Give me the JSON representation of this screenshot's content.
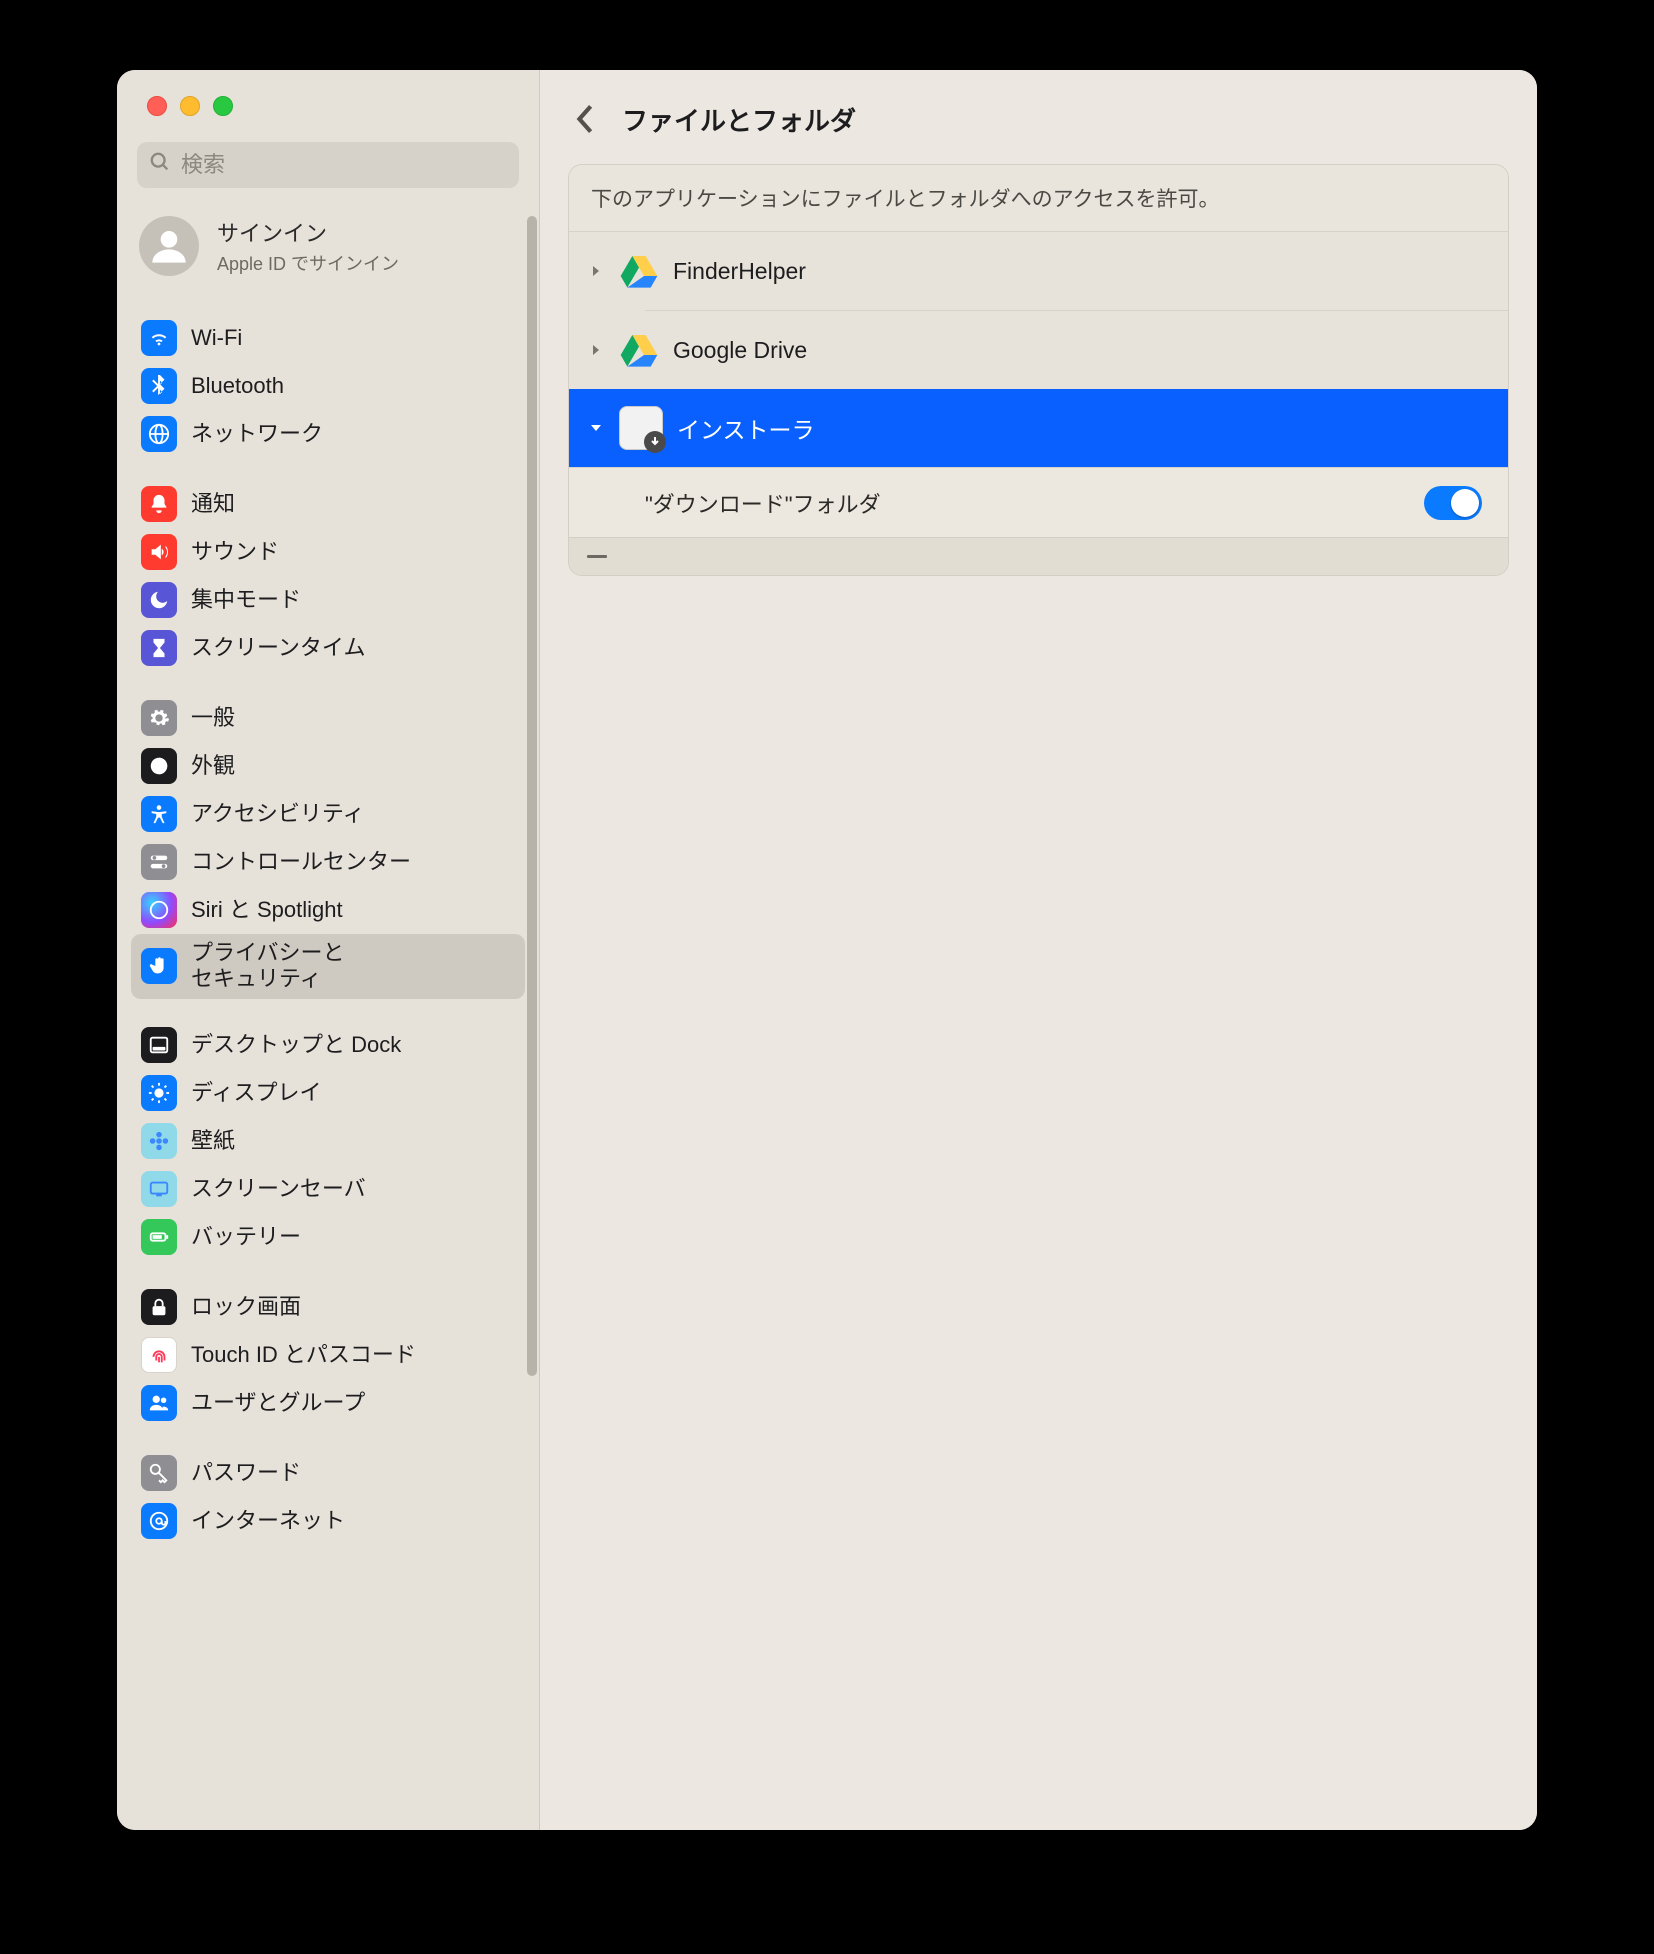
{
  "search": {
    "placeholder": "検索"
  },
  "signin": {
    "title": "サインイン",
    "subtitle": "Apple ID でサインイン"
  },
  "sidebar": {
    "groups": [
      {
        "items": [
          {
            "label": "Wi-Fi",
            "icon": "wifi-icon",
            "color": "ic-blue"
          },
          {
            "label": "Bluetooth",
            "icon": "bluetooth-icon",
            "color": "ic-blue"
          },
          {
            "label": "ネットワーク",
            "icon": "network-icon",
            "color": "ic-blue"
          }
        ]
      },
      {
        "items": [
          {
            "label": "通知",
            "icon": "bell-icon",
            "color": "ic-red"
          },
          {
            "label": "サウンド",
            "icon": "speaker-icon",
            "color": "ic-red"
          },
          {
            "label": "集中モード",
            "icon": "moon-icon",
            "color": "ic-purple"
          },
          {
            "label": "スクリーンタイム",
            "icon": "hourglass-icon",
            "color": "ic-purple"
          }
        ]
      },
      {
        "items": [
          {
            "label": "一般",
            "icon": "gear-icon",
            "color": "ic-gray"
          },
          {
            "label": "外観",
            "icon": "appearance-icon",
            "color": "ic-black"
          },
          {
            "label": "アクセシビリティ",
            "icon": "accessibility-icon",
            "color": "ic-blue"
          },
          {
            "label": "コントロールセンター",
            "icon": "switches-icon",
            "color": "ic-gray"
          },
          {
            "label": "Siri と Spotlight",
            "icon": "siri-icon",
            "color": "ic-siri"
          },
          {
            "label": "プライバシーと\nセキュリティ",
            "icon": "hand-icon",
            "color": "ic-blue",
            "selected": true
          }
        ]
      },
      {
        "items": [
          {
            "label": "デスクトップと Dock",
            "icon": "dock-icon",
            "color": "ic-black"
          },
          {
            "label": "ディスプレイ",
            "icon": "display-icon",
            "color": "ic-blue"
          },
          {
            "label": "壁紙",
            "icon": "wallpaper-icon",
            "color": "ic-cyan"
          },
          {
            "label": "スクリーンセーバ",
            "icon": "screensaver-icon",
            "color": "ic-cyan"
          },
          {
            "label": "バッテリー",
            "icon": "battery-icon",
            "color": "ic-green"
          }
        ]
      },
      {
        "items": [
          {
            "label": "ロック画面",
            "icon": "lock-icon",
            "color": "ic-black"
          },
          {
            "label": "Touch ID とパスコード",
            "icon": "touchid-icon",
            "color": "ic-white"
          },
          {
            "label": "ユーザとグループ",
            "icon": "users-icon",
            "color": "ic-blue"
          }
        ]
      },
      {
        "items": [
          {
            "label": "パスワード",
            "icon": "key-icon",
            "color": "ic-gray"
          },
          {
            "label": "インターネット",
            "icon": "at-icon",
            "color": "ic-blue"
          }
        ]
      }
    ]
  },
  "page": {
    "title": "ファイルとフォルダ",
    "caption": "下のアプリケーションにファイルとフォルダへのアクセスを許可。",
    "apps": [
      {
        "name": "FinderHelper",
        "icon": "gdrive-icon",
        "expanded": false
      },
      {
        "name": "Google Drive",
        "icon": "gdrive-icon",
        "expanded": false
      },
      {
        "name": "インストーラ",
        "icon": "installer-icon",
        "expanded": true,
        "selected": true,
        "children": [
          {
            "label": "\"ダウンロード\"フォルダ",
            "enabled": true
          }
        ]
      }
    ]
  }
}
